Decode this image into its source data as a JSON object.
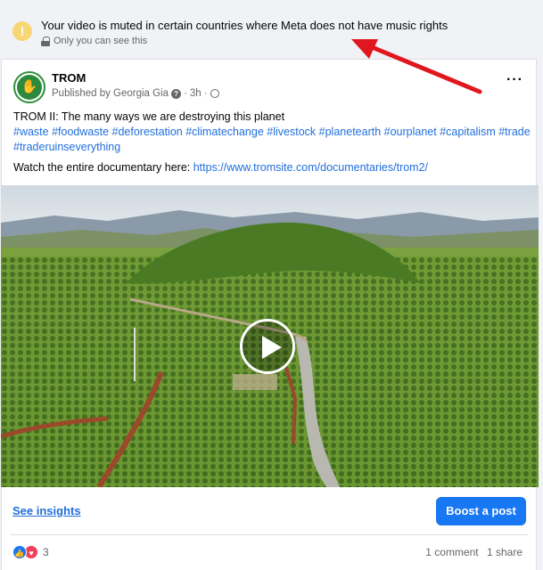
{
  "notice": {
    "title": "Your video is muted in certain countries where Meta does not have music rights",
    "subtitle": "Only you can see this",
    "icon": "warning-icon",
    "icon_color": "#f7d774"
  },
  "post": {
    "page_name": "TROM",
    "published_by": "Published by Georgia Gia",
    "time": "3h",
    "audience_icon": "globe-icon",
    "text_line": "TROM II: The many ways we are destroying this planet",
    "hashtags": [
      "#waste",
      "#foodwaste",
      "#deforestation",
      "#climatechange",
      "#livestock",
      "#planetearth",
      "#ourplanet",
      "#capitalism",
      "#trade",
      "#traderuinseverything"
    ],
    "watch_prefix": "Watch the entire documentary here: ",
    "watch_link": "https://www.tromsite.com/documentaries/trom2/"
  },
  "actions": {
    "insights_label": "See insights",
    "boost_label": "Boost a post",
    "boost_color": "#1877f2",
    "link_color": "#216fdb"
  },
  "engagement": {
    "reaction_count": "3",
    "comments": "1 comment",
    "shares": "1 share"
  }
}
